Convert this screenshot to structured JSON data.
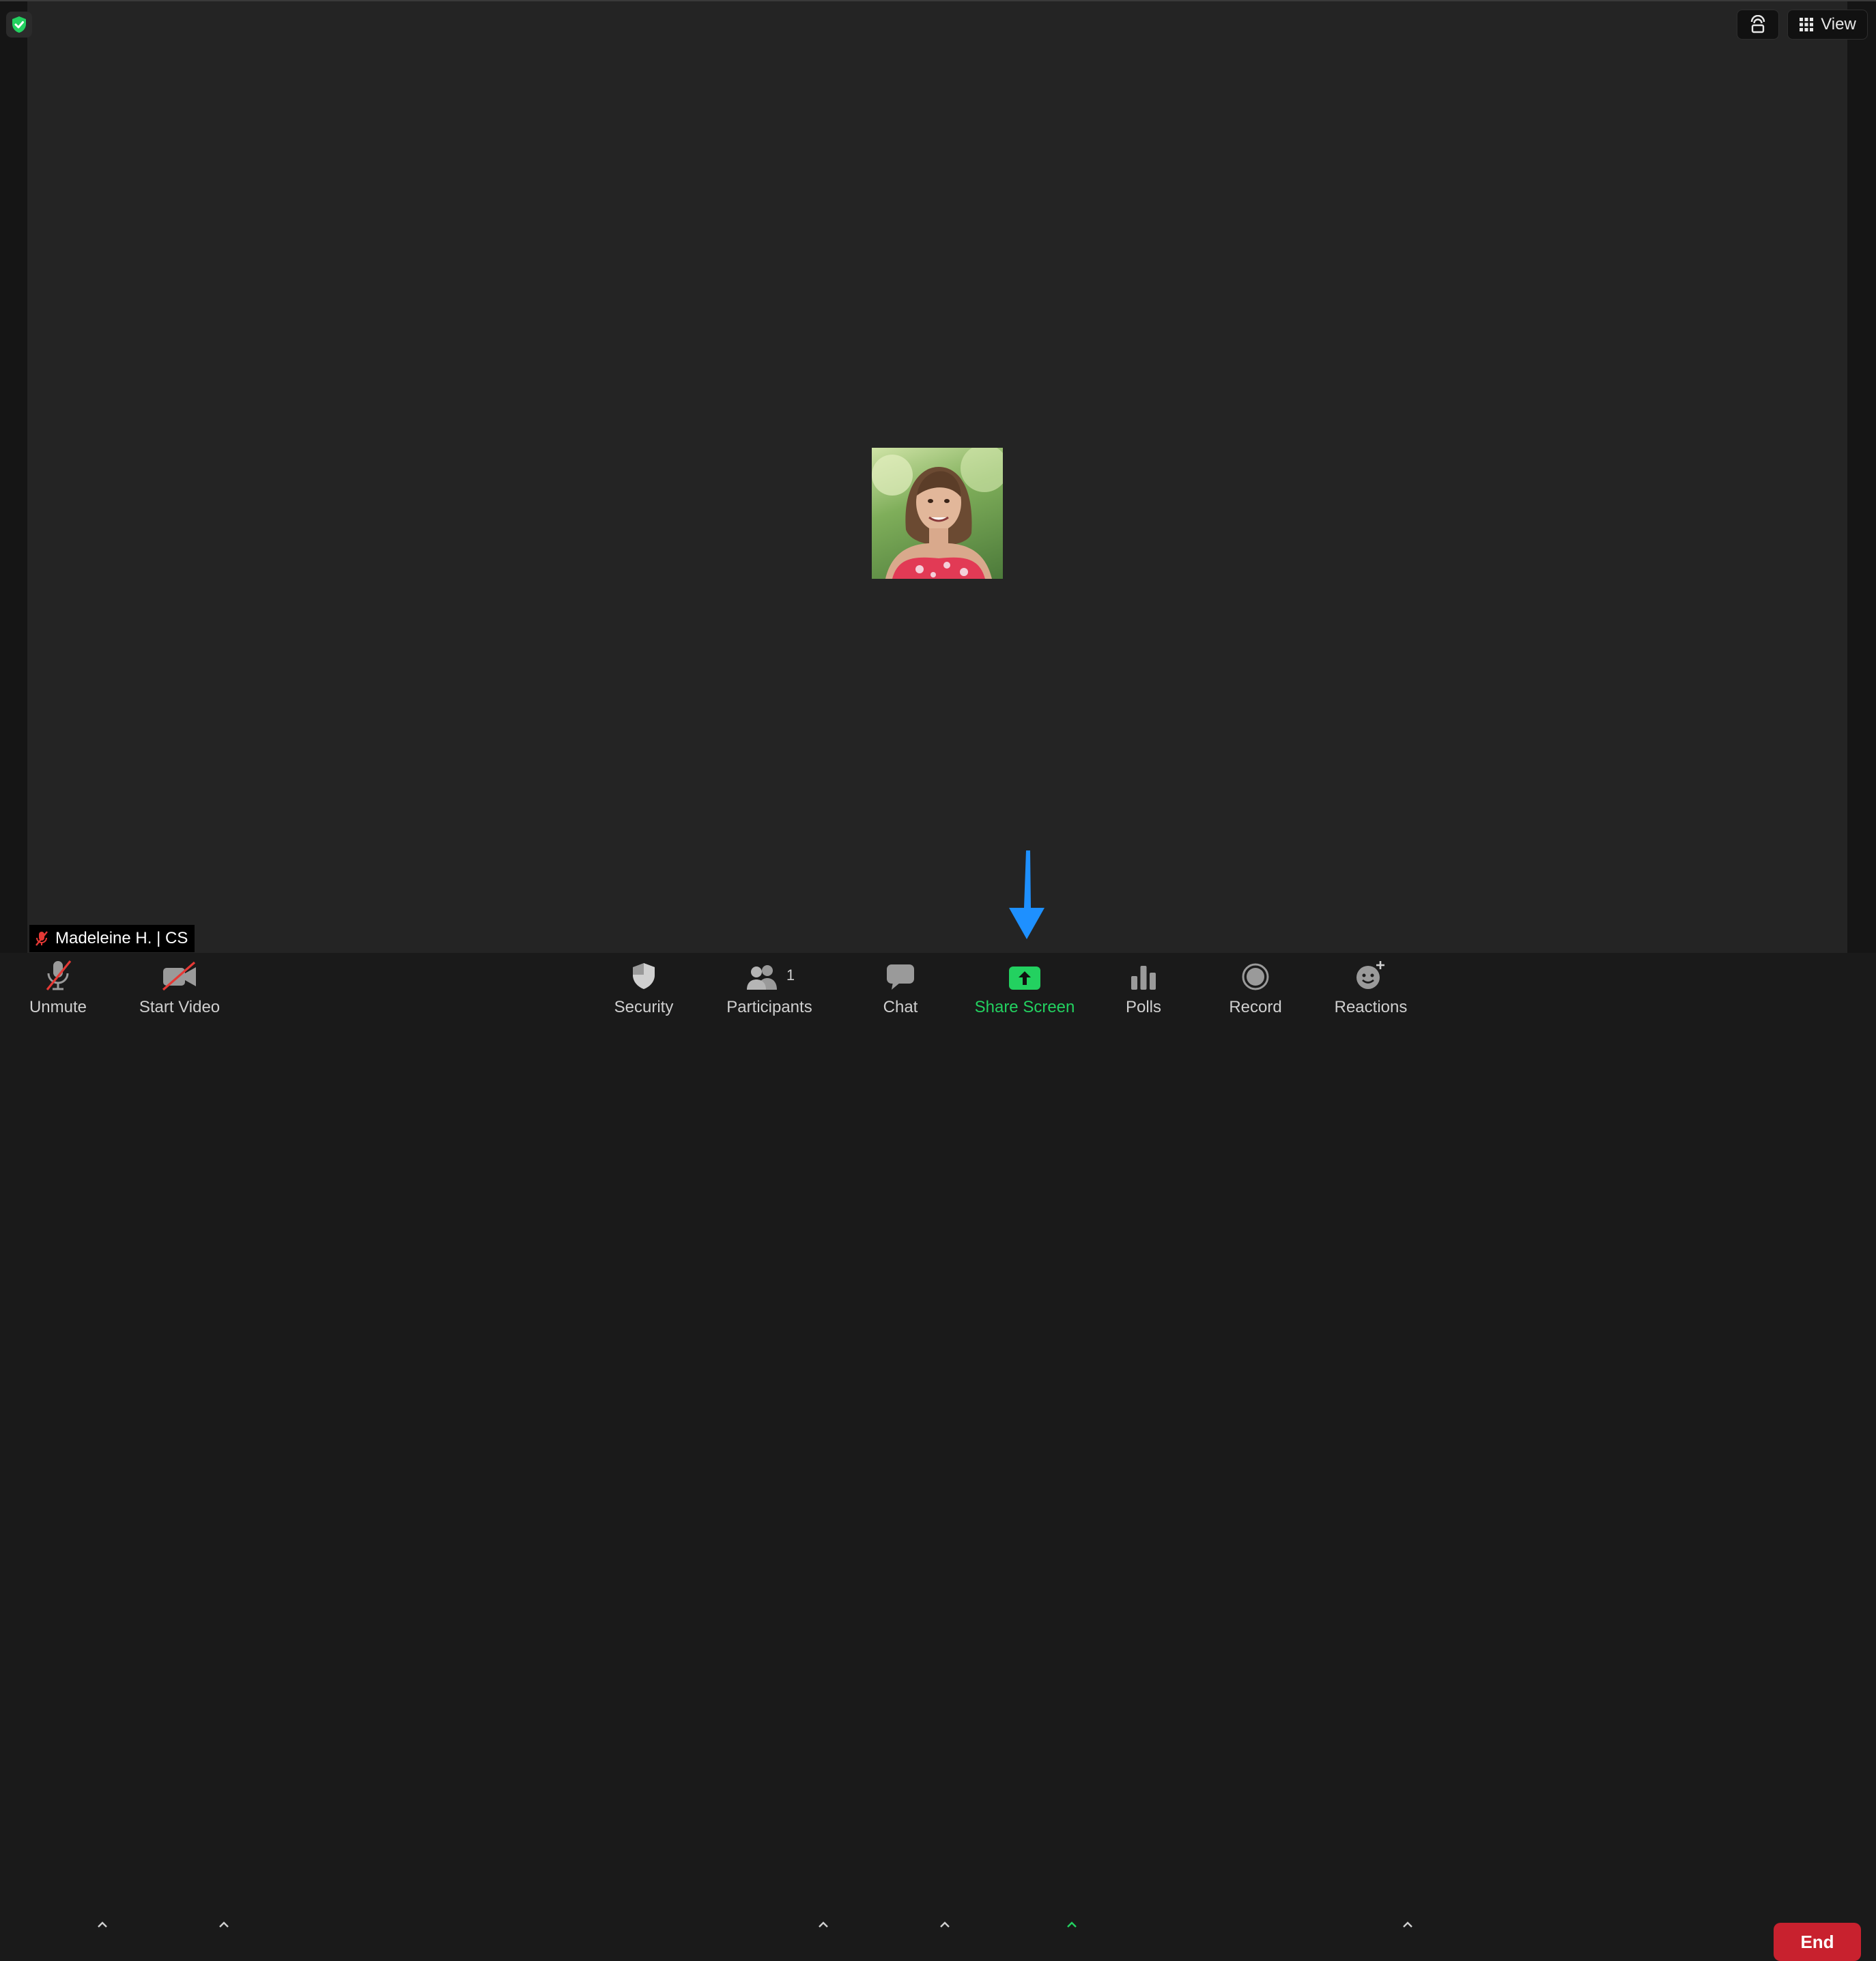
{
  "top_bar": {
    "view_label": "View"
  },
  "participant": {
    "name": "Madeleine H. | CS"
  },
  "toolbar": {
    "unmute_label": "Unmute",
    "start_video_label": "Start Video",
    "security_label": "Security",
    "participants_label": "Participants",
    "participants_count": "1",
    "chat_label": "Chat",
    "share_screen_label": "Share Screen",
    "polls_label": "Polls",
    "record_label": "Record",
    "reactions_label": "Reactions",
    "end_label": "End"
  },
  "colors": {
    "share_green": "#23d160",
    "end_red": "#c8212e",
    "arrow_blue": "#1e90ff",
    "muted_red": "#e53935"
  }
}
